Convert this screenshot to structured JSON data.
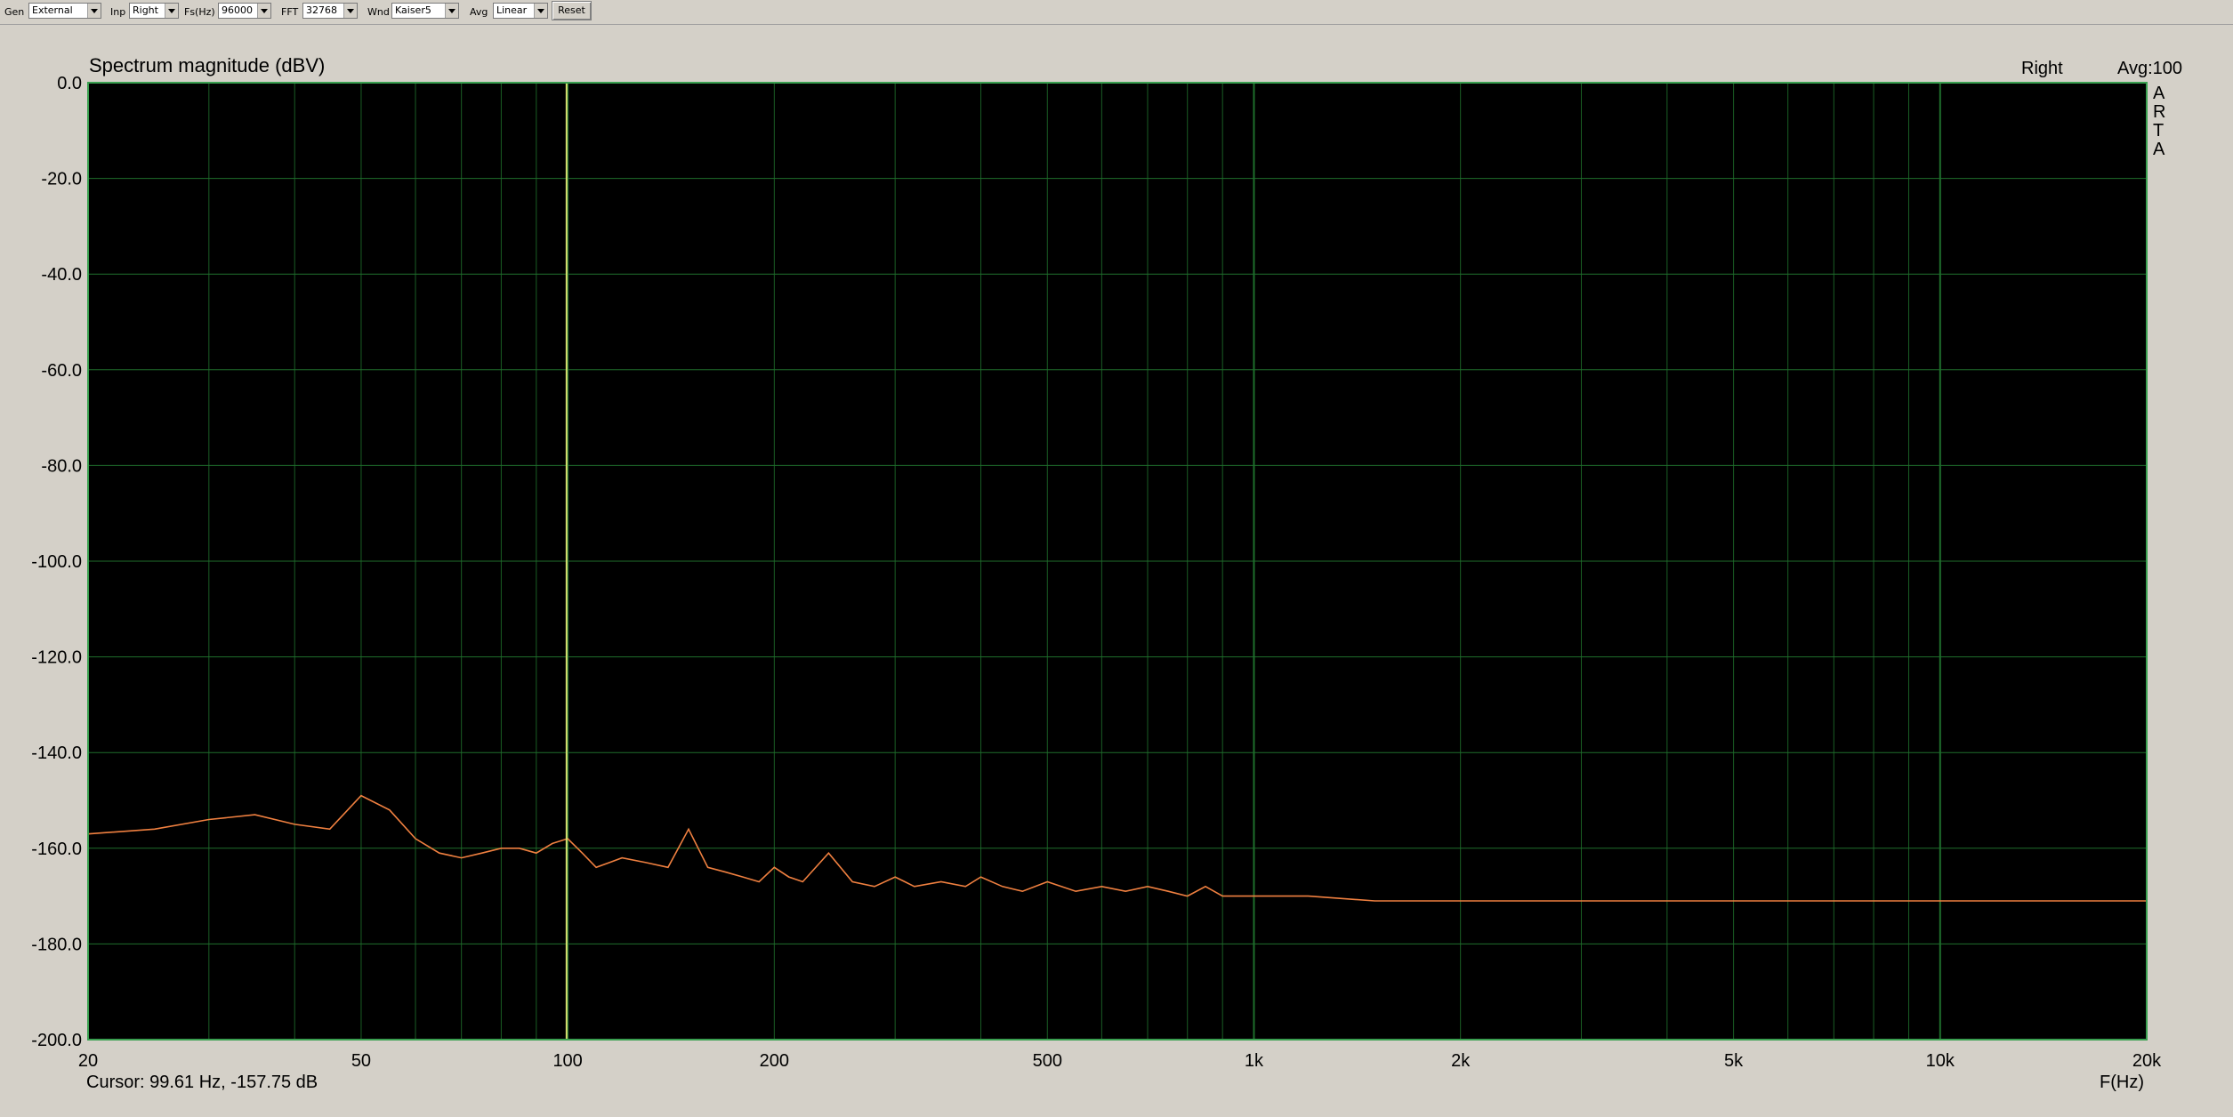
{
  "toolbar": {
    "gen_label": "Gen",
    "gen_value": "External",
    "inp_label": "Inp",
    "inp_value": "Right",
    "fs_label": "Fs(Hz)",
    "fs_value": "96000",
    "fft_label": "FFT",
    "fft_value": "32768",
    "wnd_label": "Wnd",
    "wnd_value": "Kaiser5",
    "avg_label": "Avg",
    "avg_value": "Linear",
    "reset_label": "Reset"
  },
  "plot": {
    "title": "Spectrum magnitude (dBV)",
    "channel": "Right",
    "avg_text": "Avg:100",
    "side_letters": [
      "A",
      "R",
      "T",
      "A"
    ],
    "cursor_text": "Cursor: 99.61 Hz, -157.75 dB",
    "xlabel": "F(Hz)"
  },
  "colors": {
    "background": "#d4d0c8",
    "plot_bg": "#000000",
    "grid": "#1f6e2c",
    "trace": "#f08040",
    "cursor": "#d8e070"
  },
  "chart_data": {
    "type": "line",
    "title": "Spectrum magnitude (dBV)",
    "xlabel": "F(Hz)",
    "ylabel": "",
    "xscale": "log",
    "xlim": [
      20,
      20000
    ],
    "ylim": [
      -200,
      0
    ],
    "grid": true,
    "y_ticks": [
      0,
      -20,
      -40,
      -60,
      -80,
      -100,
      -120,
      -140,
      -160,
      -180,
      -200
    ],
    "y_tick_labels": [
      "0.0",
      "-20.0",
      "-40.0",
      "-60.0",
      "-80.0",
      "-100.0",
      "-120.0",
      "-140.0",
      "-160.0",
      "-180.0",
      "-200.0"
    ],
    "x_ticks": [
      20,
      50,
      100,
      200,
      500,
      1000,
      2000,
      5000,
      10000,
      20000
    ],
    "x_tick_labels": [
      "20",
      "50",
      "100",
      "200",
      "500",
      "1k",
      "2k",
      "5k",
      "10k",
      "20k"
    ],
    "cursor": {
      "frequency": 99.61,
      "level": -157.75
    },
    "series": [
      {
        "x": [
          20,
          25,
          30,
          35,
          40,
          45,
          50,
          55,
          60,
          65,
          70,
          75,
          80,
          85,
          90,
          95,
          100,
          105,
          110,
          115,
          120,
          130,
          140,
          150,
          160,
          170,
          180,
          190,
          200,
          210,
          220,
          240,
          260,
          280,
          300,
          320,
          350,
          380,
          400,
          430,
          460,
          500,
          550,
          600,
          650,
          700,
          750,
          800,
          850,
          900,
          1000,
          1200,
          1500,
          2000,
          3000,
          5000,
          10000,
          20000
        ],
        "values": [
          -157,
          -156,
          -154,
          -153,
          -155,
          -156,
          -149,
          -152,
          -158,
          -161,
          -162,
          -161,
          -160,
          -160,
          -161,
          -159,
          -158,
          -161,
          -164,
          -163,
          -162,
          -163,
          -164,
          -156,
          -164,
          -165,
          -166,
          -167,
          -164,
          -166,
          -167,
          -161,
          -167,
          -168,
          -166,
          -168,
          -167,
          -168,
          -166,
          -168,
          -169,
          -167,
          -169,
          -168,
          -169,
          -168,
          -169,
          -170,
          -168,
          -170,
          -170,
          -170,
          -171,
          -171,
          -171,
          -171,
          -171,
          -171
        ]
      }
    ]
  }
}
